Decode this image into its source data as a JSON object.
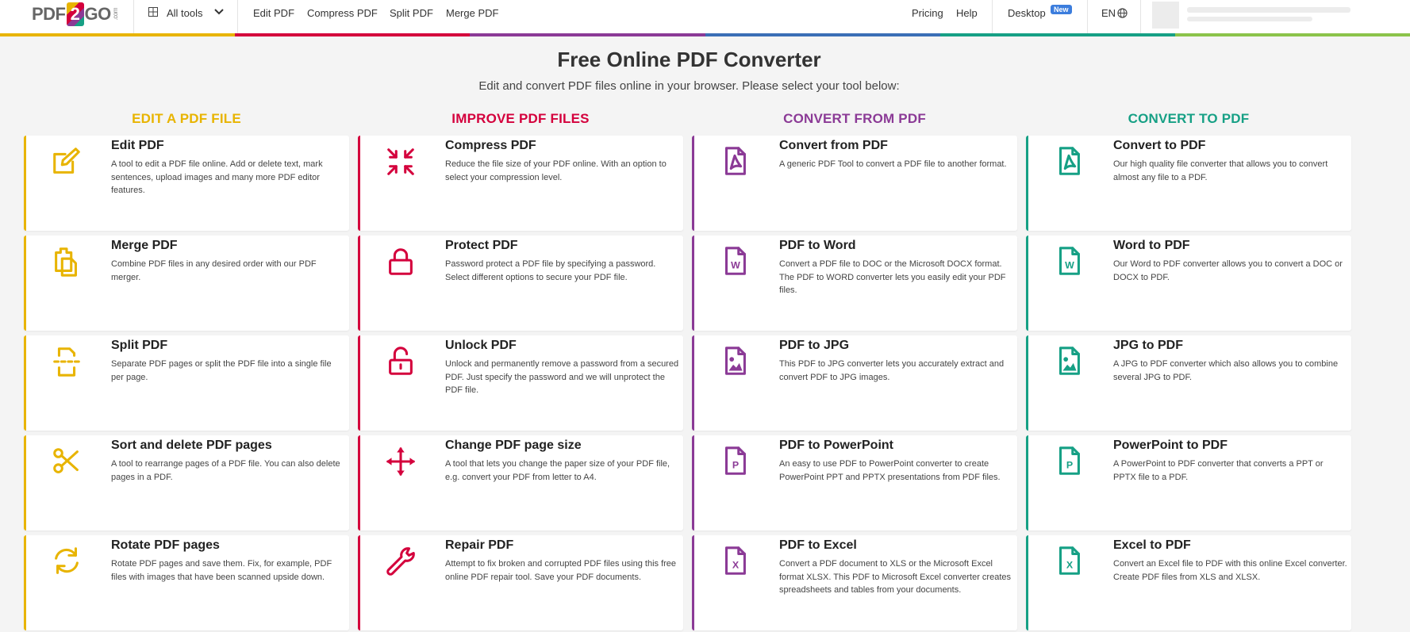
{
  "header": {
    "logo": {
      "part1": "PDF",
      "two": "2",
      "part2": "GO",
      "com": ".com"
    },
    "all_tools": "All tools",
    "nav": [
      "Edit PDF",
      "Compress PDF",
      "Split PDF",
      "Merge PDF"
    ],
    "pricing": "Pricing",
    "help": "Help",
    "desktop": "Desktop",
    "desktop_badge": "New",
    "language": "EN",
    "bar_colors": [
      "#e8b400",
      "#d4003c",
      "#8b3a96",
      "#3b6fb6",
      "#16a085",
      "#8bc34a"
    ]
  },
  "page": {
    "title": "Free Online PDF Converter",
    "subtitle": "Edit and convert PDF files online in your browser. Please select your tool below:"
  },
  "columns": [
    {
      "heading": "EDIT A PDF FILE",
      "color": "#e8b400",
      "tools": [
        {
          "title": "Edit PDF",
          "desc": "A tool to edit a PDF file online. Add or delete text, mark sentences, upload images and many more PDF editor features.",
          "icon": "edit-icon"
        },
        {
          "title": "Merge PDF",
          "desc": "Combine PDF files in any desired order with our PDF merger.",
          "icon": "merge-icon"
        },
        {
          "title": "Split PDF",
          "desc": "Separate PDF pages or split the PDF file into a single file per page.",
          "icon": "split-icon"
        },
        {
          "title": "Sort and delete PDF pages",
          "desc": "A tool to rearrange pages of a PDF file. You can also delete pages in a PDF.",
          "icon": "scissors-icon"
        },
        {
          "title": "Rotate PDF pages",
          "desc": "Rotate PDF pages and save them. Fix, for example, PDF files with images that have been scanned upside down.",
          "icon": "rotate-icon"
        }
      ]
    },
    {
      "heading": "IMPROVE PDF FILES",
      "color": "#d4003c",
      "tools": [
        {
          "title": "Compress PDF",
          "desc": "Reduce the file size of your PDF online. With an option to select your compression level.",
          "icon": "compress-icon"
        },
        {
          "title": "Protect PDF",
          "desc": "Password protect a PDF file by specifying a password. Select different options to secure your PDF file.",
          "icon": "lock-icon"
        },
        {
          "title": "Unlock PDF",
          "desc": "Unlock and permanently remove a password from a secured PDF. Just specify the password and we will unprotect the PDF file.",
          "icon": "unlock-icon"
        },
        {
          "title": "Change PDF page size",
          "desc": "A tool that lets you change the paper size of your PDF file, e.g. convert your PDF from letter to A4.",
          "icon": "move-icon"
        },
        {
          "title": "Repair PDF",
          "desc": "Attempt to fix broken and corrupted PDF files using this free online PDF repair tool. Save your PDF documents.",
          "icon": "wrench-icon"
        }
      ]
    },
    {
      "heading": "CONVERT FROM PDF",
      "color": "#8b3a96",
      "tools": [
        {
          "title": "Convert from PDF",
          "desc": "A generic PDF Tool to convert a PDF file to another format.",
          "icon": "pdf-file-icon"
        },
        {
          "title": "PDF to Word",
          "desc": "Convert a PDF file to DOC or the Microsoft DOCX format. The PDF to WORD converter lets you easily edit your PDF files.",
          "icon": "word-file-icon"
        },
        {
          "title": "PDF to JPG",
          "desc": "This PDF to JPG converter lets you accurately extract and convert PDF to JPG images.",
          "icon": "image-file-icon"
        },
        {
          "title": "PDF to PowerPoint",
          "desc": "An easy to use PDF to PowerPoint converter to create PowerPoint PPT and PPTX presentations from PDF files.",
          "icon": "powerpoint-file-icon"
        },
        {
          "title": "PDF to Excel",
          "desc": "Convert a PDF document to XLS or the Microsoft Excel format XLSX. This PDF to Microsoft Excel converter creates spreadsheets and tables from your documents.",
          "icon": "excel-file-icon"
        }
      ]
    },
    {
      "heading": "CONVERT TO PDF",
      "color": "#16a085",
      "tools": [
        {
          "title": "Convert to PDF",
          "desc": "Our high quality file converter that allows you to convert almost any file to a PDF.",
          "icon": "pdf-file-icon"
        },
        {
          "title": "Word to PDF",
          "desc": "Our Word to PDF converter allows you to convert a DOC or DOCX to PDF.",
          "icon": "word-file-icon"
        },
        {
          "title": "JPG to PDF",
          "desc": "A JPG to PDF converter which also allows you to combine several JPG to PDF.",
          "icon": "image-file-icon"
        },
        {
          "title": "PowerPoint to PDF",
          "desc": "A PowerPoint to PDF converter that converts a PPT or PPTX file to a PDF.",
          "icon": "powerpoint-file-icon"
        },
        {
          "title": "Excel to PDF",
          "desc": "Convert an Excel file to PDF with this online Excel converter. Create PDF files from XLS and XLSX.",
          "icon": "excel-file-icon"
        }
      ]
    }
  ]
}
